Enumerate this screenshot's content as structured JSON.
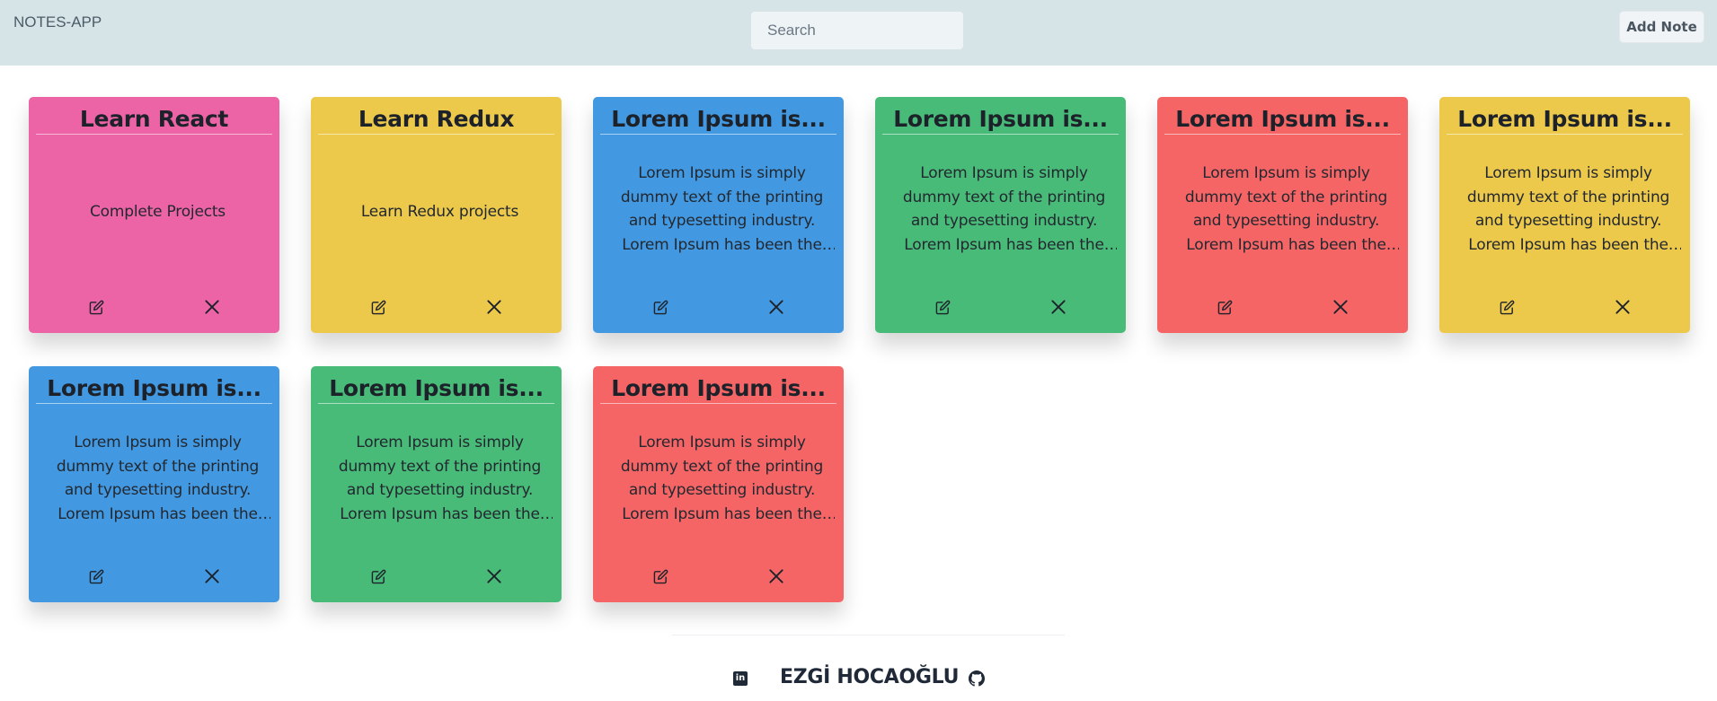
{
  "navbar": {
    "brand": "NOTES-APP",
    "search_placeholder": "Search",
    "add_note_label": "Add Note"
  },
  "notes": [
    {
      "title": "Learn React",
      "body": "Complete Projects",
      "color": "#ec64a6"
    },
    {
      "title": "Learn Redux",
      "body": "Learn Redux projects",
      "color": "#ecc94b"
    },
    {
      "title": "Lorem Ipsum is...",
      "body": "Lorem Ipsum is simply dummy text of the printing and typesetting industry. Lorem Ipsum has been the industry's...",
      "color": "#4299e1"
    },
    {
      "title": "Lorem Ipsum is...",
      "body": "Lorem Ipsum is simply dummy text of the printing and typesetting industry. Lorem Ipsum has been the industry's...",
      "color": "#48bb78"
    },
    {
      "title": "Lorem Ipsum is...",
      "body": "Lorem Ipsum is simply dummy text of the printing and typesetting industry. Lorem Ipsum has been the industry's...",
      "color": "#f56565"
    },
    {
      "title": "Lorem Ipsum is...",
      "body": "Lorem Ipsum is simply dummy text of the printing and typesetting industry. Lorem Ipsum has been the industry's...",
      "color": "#ecc94b"
    },
    {
      "title": "Lorem Ipsum is...",
      "body": "Lorem Ipsum is simply dummy text of the printing and typesetting industry. Lorem Ipsum has been the industry's...",
      "color": "#4299e1"
    },
    {
      "title": "Lorem Ipsum is...",
      "body": "Lorem Ipsum is simply dummy text of the printing and typesetting industry. Lorem Ipsum has been the industry's...",
      "color": "#48bb78"
    },
    {
      "title": "Lorem Ipsum is...",
      "body": "Lorem Ipsum is simply dummy text of the printing and typesetting industry. Lorem Ipsum has been the industry's...",
      "color": "#f56565"
    }
  ],
  "icons": {
    "edit": "edit-icon",
    "delete": "close-icon",
    "linkedin": "linkedin-icon",
    "github": "github-icon"
  },
  "footer": {
    "author": "EZGİ HOCAOĞLU"
  }
}
